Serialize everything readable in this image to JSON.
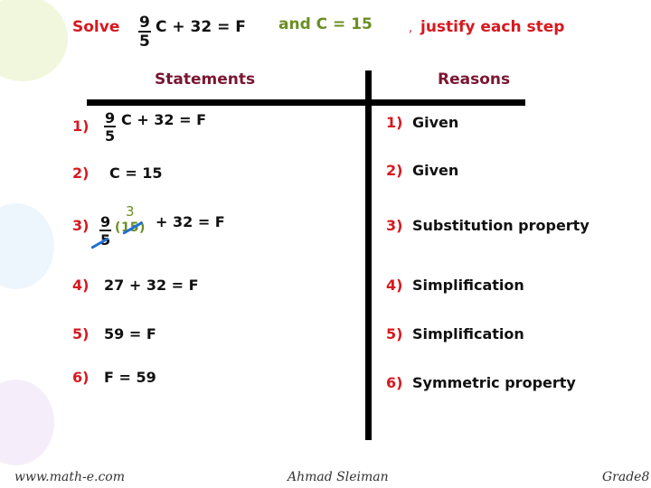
{
  "title": {
    "solve": "Solve",
    "frac_num": "9",
    "frac_den": "5",
    "equation_rest": "C + 32 = F",
    "given_value": "and C = 15",
    "comma": ",",
    "instruction": "justify each step"
  },
  "headers": {
    "statements": "Statements",
    "reasons": "Reasons"
  },
  "rows": [
    {
      "num": "1)",
      "statement": {
        "frac_num": "9",
        "frac_den": "5",
        "rest": "C + 32 = F"
      },
      "reason": "Given"
    },
    {
      "num": "2)",
      "statement": {
        "text": "C = 15"
      },
      "reason": "Given"
    },
    {
      "num": "3)",
      "statement": {
        "frac_num": "9",
        "frac_den": "5",
        "paren_open": "(",
        "paren_value": "15",
        "paren_close": ")",
        "reduced_value": "3",
        "rest": "+ 32 = F"
      },
      "reason": "Substitution property"
    },
    {
      "num": "4)",
      "statement": {
        "text": "27 + 32 = F"
      },
      "reason": "Simplification"
    },
    {
      "num": "5)",
      "statement": {
        "text": "59 = F"
      },
      "reason": "Simplification"
    },
    {
      "num": "6)",
      "statement": {
        "text": "F = 59"
      },
      "reason": "Symmetric property"
    }
  ],
  "footer": {
    "website": "www.math-e.com",
    "author": "Ahmad Sleiman",
    "grade": "Grade8"
  },
  "colors": {
    "label_red": "#d7191f",
    "header_maroon": "#7a1632",
    "given_green": "#6b8e23",
    "cancel_blue": "#1f6fd6"
  }
}
